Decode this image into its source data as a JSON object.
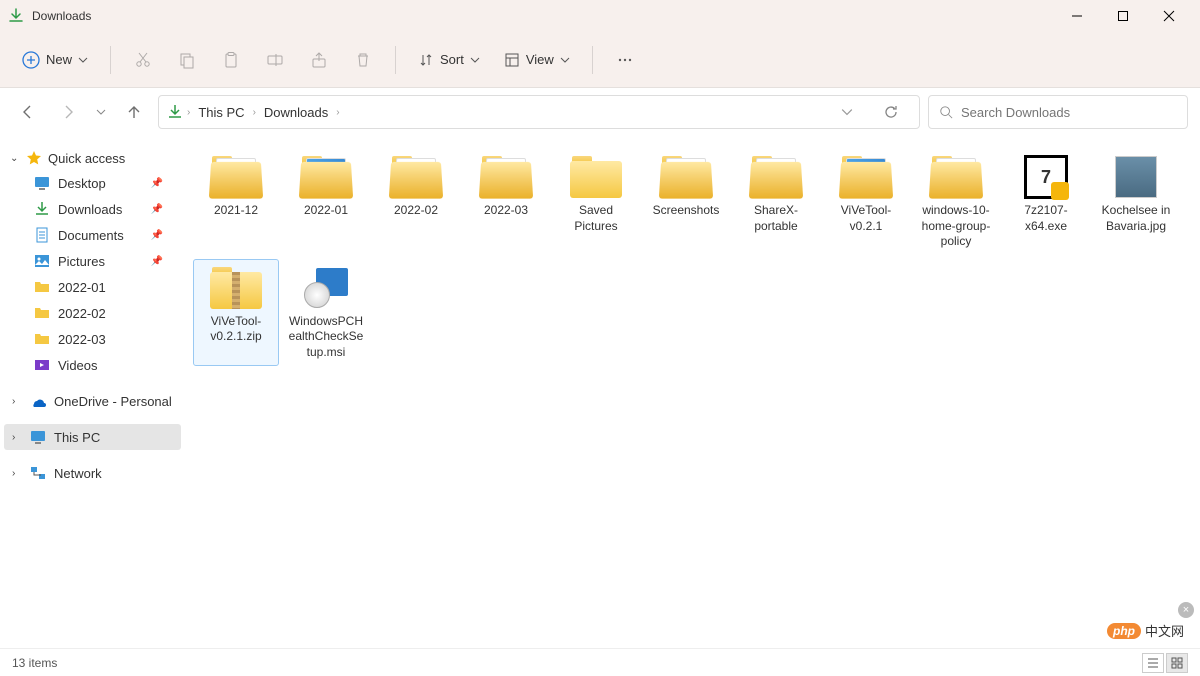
{
  "window": {
    "title": "Downloads"
  },
  "toolbar": {
    "new_label": "New",
    "sort_label": "Sort",
    "view_label": "View"
  },
  "breadcrumb": {
    "items": [
      "This PC",
      "Downloads"
    ]
  },
  "search": {
    "placeholder": "Search Downloads"
  },
  "sidebar": {
    "quick_access": {
      "label": "Quick access",
      "items": [
        {
          "label": "Desktop",
          "pinned": true,
          "icon": "desktop"
        },
        {
          "label": "Downloads",
          "pinned": true,
          "icon": "downloads"
        },
        {
          "label": "Documents",
          "pinned": true,
          "icon": "documents"
        },
        {
          "label": "Pictures",
          "pinned": true,
          "icon": "pictures"
        },
        {
          "label": "2022-01",
          "pinned": false,
          "icon": "folder"
        },
        {
          "label": "2022-02",
          "pinned": false,
          "icon": "folder"
        },
        {
          "label": "2022-03",
          "pinned": false,
          "icon": "folder"
        },
        {
          "label": "Videos",
          "pinned": false,
          "icon": "videos"
        }
      ]
    },
    "onedrive": {
      "label": "OneDrive - Personal"
    },
    "this_pc": {
      "label": "This PC"
    },
    "network": {
      "label": "Network"
    }
  },
  "files": [
    {
      "name": "2021-12",
      "type": "folder-open",
      "selected": false
    },
    {
      "name": "2022-01",
      "type": "folder-preview-img",
      "selected": false
    },
    {
      "name": "2022-02",
      "type": "folder-preview",
      "selected": false
    },
    {
      "name": "2022-03",
      "type": "folder-preview",
      "selected": false
    },
    {
      "name": "Saved Pictures",
      "type": "folder",
      "selected": false
    },
    {
      "name": "Screenshots",
      "type": "folder-open",
      "selected": false
    },
    {
      "name": "ShareX-portable",
      "type": "folder-open",
      "selected": false
    },
    {
      "name": "ViVeTool-v0.2.1",
      "type": "folder-preview-img",
      "selected": false
    },
    {
      "name": "windows-10-home-group-policy",
      "type": "folder-open",
      "selected": false
    },
    {
      "name": "7z2107-x64.exe",
      "type": "exe-7z",
      "selected": false
    },
    {
      "name": "Kochelsee in Bavaria.jpg",
      "type": "image",
      "selected": false
    },
    {
      "name": "ViVeTool-v0.2.1.zip",
      "type": "zip",
      "selected": true
    },
    {
      "name": "WindowsPCHealthCheckSetup.msi",
      "type": "msi",
      "selected": false
    }
  ],
  "status": {
    "count_label": "13 items"
  },
  "watermark": {
    "badge": "php",
    "text": "中文网"
  }
}
